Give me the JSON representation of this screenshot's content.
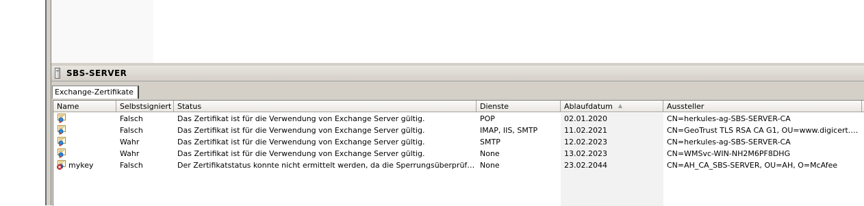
{
  "panel": {
    "title": "SBS-SERVER",
    "tab_label": "Exchange-Zertifikate"
  },
  "columns": [
    {
      "key": "name",
      "label": "Name"
    },
    {
      "key": "self_signed",
      "label": "Selbstsigniert"
    },
    {
      "key": "status",
      "label": "Status"
    },
    {
      "key": "services",
      "label": "Dienste"
    },
    {
      "key": "expiry",
      "label": "Ablaufdatum",
      "sort": "ascending"
    },
    {
      "key": "issuer",
      "label": "Aussteller"
    }
  ],
  "rows": [
    {
      "icon": "certificate-icon",
      "name": "",
      "self_signed": "Falsch",
      "status": "Das Zertifikat ist für die Verwendung von Exchange Server gültig.",
      "services": "POP",
      "expiry": "02.01.2020",
      "issuer": "CN=herkules-ag-SBS-SERVER-CA"
    },
    {
      "icon": "certificate-icon",
      "name": "",
      "self_signed": "Falsch",
      "status": "Das Zertifikat ist für die Verwendung von Exchange Server gültig.",
      "services": "IMAP, IIS, SMTP",
      "expiry": "11.02.2021",
      "issuer": "CN=GeoTrust TLS RSA CA G1, OU=www.digicert.com, ..."
    },
    {
      "icon": "certificate-icon",
      "name": "",
      "self_signed": "Wahr",
      "status": "Das Zertifikat ist für die Verwendung von Exchange Server gültig.",
      "services": "SMTP",
      "expiry": "12.02.2023",
      "issuer": "CN=herkules-ag-SBS-SERVER-CA"
    },
    {
      "icon": "certificate-icon",
      "name": "",
      "self_signed": "Wahr",
      "status": "Das Zertifikat ist für die Verwendung von Exchange Server gültig.",
      "services": "None",
      "expiry": "13.02.2023",
      "issuer": "CN=WMSvc-WIN-NH2M6PF8DHG"
    },
    {
      "icon": "certificate-error-icon",
      "name": "mykey",
      "self_signed": "Falsch",
      "status": "Der Zertifikatstatus konnte nicht ermittelt werden, da die Sperrungsüberprüfung keine...",
      "services": "None",
      "expiry": "23.02.2044",
      "issuer": "CN=AH_CA_SBS-SERVER, OU=AH, O=McAfee"
    }
  ]
}
